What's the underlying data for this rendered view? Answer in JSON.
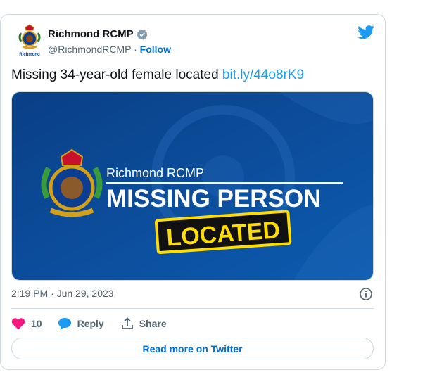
{
  "tweet": {
    "author_name": "Richmond RCMP",
    "handle": "@RichmondRCMP",
    "separator": " · ",
    "follow_label": "Follow",
    "text": "Missing 34-year-old female located ",
    "link": "bit.ly/44o8rK9",
    "media": {
      "org_line": "Richmond RCMP",
      "headline": "MISSING PERSON",
      "stamp": "LOCATED"
    },
    "time": "2:19 PM",
    "date": "Jun 29, 2023",
    "likes": "10",
    "reply_label": "Reply",
    "share_label": "Share",
    "read_more_label": "Read more on Twitter"
  },
  "avatar_caption": "Richmond",
  "colors": {
    "link_blue": "#1d9bf0",
    "follow_blue": "#006fd6",
    "heart_pink": "#f91880",
    "banner_blue": "#0d4c95",
    "stamp_yellow": "#ffdd00"
  },
  "icons": [
    "verified-badge-icon",
    "twitter-bird-icon",
    "info-icon",
    "heart-icon",
    "reply-bubble-icon",
    "share-icon"
  ]
}
